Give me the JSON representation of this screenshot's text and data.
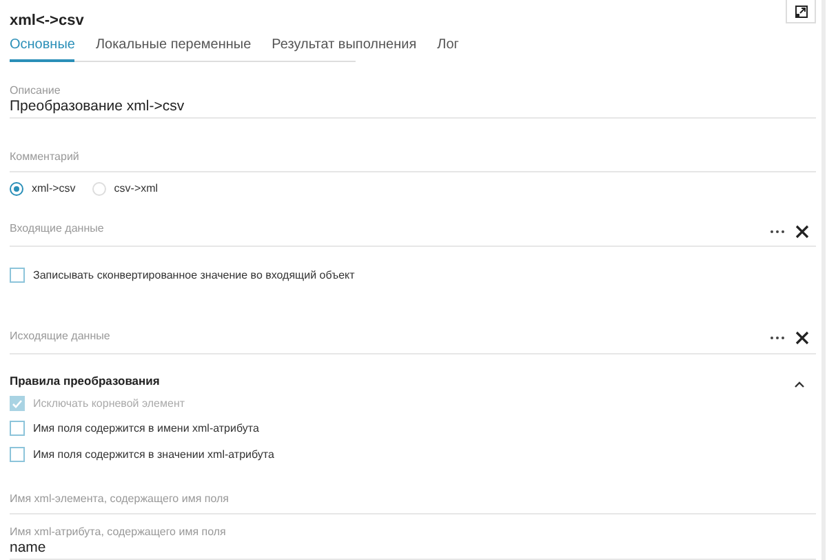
{
  "title": "xml<->csv",
  "tabs": [
    {
      "label": "Основные",
      "selected": true
    },
    {
      "label": "Локальные переменные",
      "selected": false
    },
    {
      "label": "Результат выполнения",
      "selected": false
    },
    {
      "label": "Лог",
      "selected": false
    }
  ],
  "items": [
    {
      "kind": "text",
      "label": "Описание",
      "value": "Преобразование xml->csv"
    },
    {
      "kind": "text",
      "placeholder": "Комментарий"
    },
    {
      "kind": "radio",
      "options": [
        {
          "label": "xml->csv",
          "selected": true
        },
        {
          "label": "csv->xml",
          "selected": false
        }
      ]
    },
    {
      "kind": "picker",
      "placeholder": "Входящие данные"
    },
    {
      "kind": "checkbox",
      "label": "Записывать сконвертированное значение во входящий объект",
      "checked": false,
      "disabled": false
    },
    {
      "kind": "picker",
      "placeholder": "Исходящие данные"
    },
    {
      "kind": "section",
      "label": "Правила преобразования",
      "expanded": true
    },
    {
      "kind": "checkbox",
      "label": "Исключать корневой элемент",
      "checked": true,
      "disabled": true
    },
    {
      "kind": "checkbox",
      "label": "Имя поля содержится в имени xml-атрибута",
      "checked": false,
      "disabled": false
    },
    {
      "kind": "checkbox",
      "label": "Имя поля содержится в значении xml-атрибута",
      "checked": false,
      "disabled": false
    },
    {
      "kind": "text",
      "placeholder": "Имя xml-элемента, содержащего имя поля"
    },
    {
      "kind": "text",
      "label": "Имя xml-атрибута, содержащего имя поля",
      "value": "name"
    }
  ]
}
